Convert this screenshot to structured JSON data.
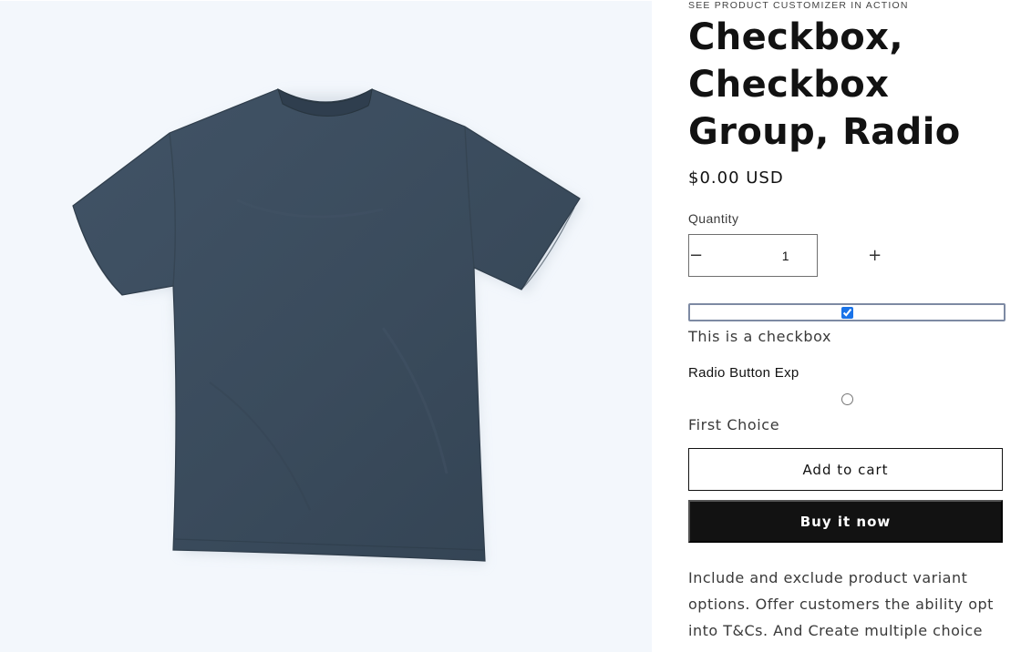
{
  "product": {
    "eyebrow": "SEE PRODUCT CUSTOMIZER IN ACTION",
    "title": "Checkbox, Checkbox Group, Radio",
    "price": "$0.00 USD",
    "image_alt": "Dark heather navy t-shirt"
  },
  "quantity": {
    "label": "Quantity",
    "value": "1",
    "decrease_symbol": "−",
    "increase_symbol": "+"
  },
  "options": {
    "checkbox_label": "This is a checkbox",
    "checkbox_checked": true,
    "radio_heading": "Radio Button Exp",
    "radio_label": "First Choice",
    "radio_checked": false
  },
  "actions": {
    "add_to_cart": "Add to cart",
    "buy_now": "Buy it now"
  },
  "description": "Include and exclude product variant options. Offer customers the ability opt into T&Cs. And Create multiple choice",
  "colors": {
    "shirt": "#3a4b5c",
    "media_background": "#f3f7fc",
    "primary_button": "#121212",
    "accent_checkbox": "#1a73e8"
  }
}
